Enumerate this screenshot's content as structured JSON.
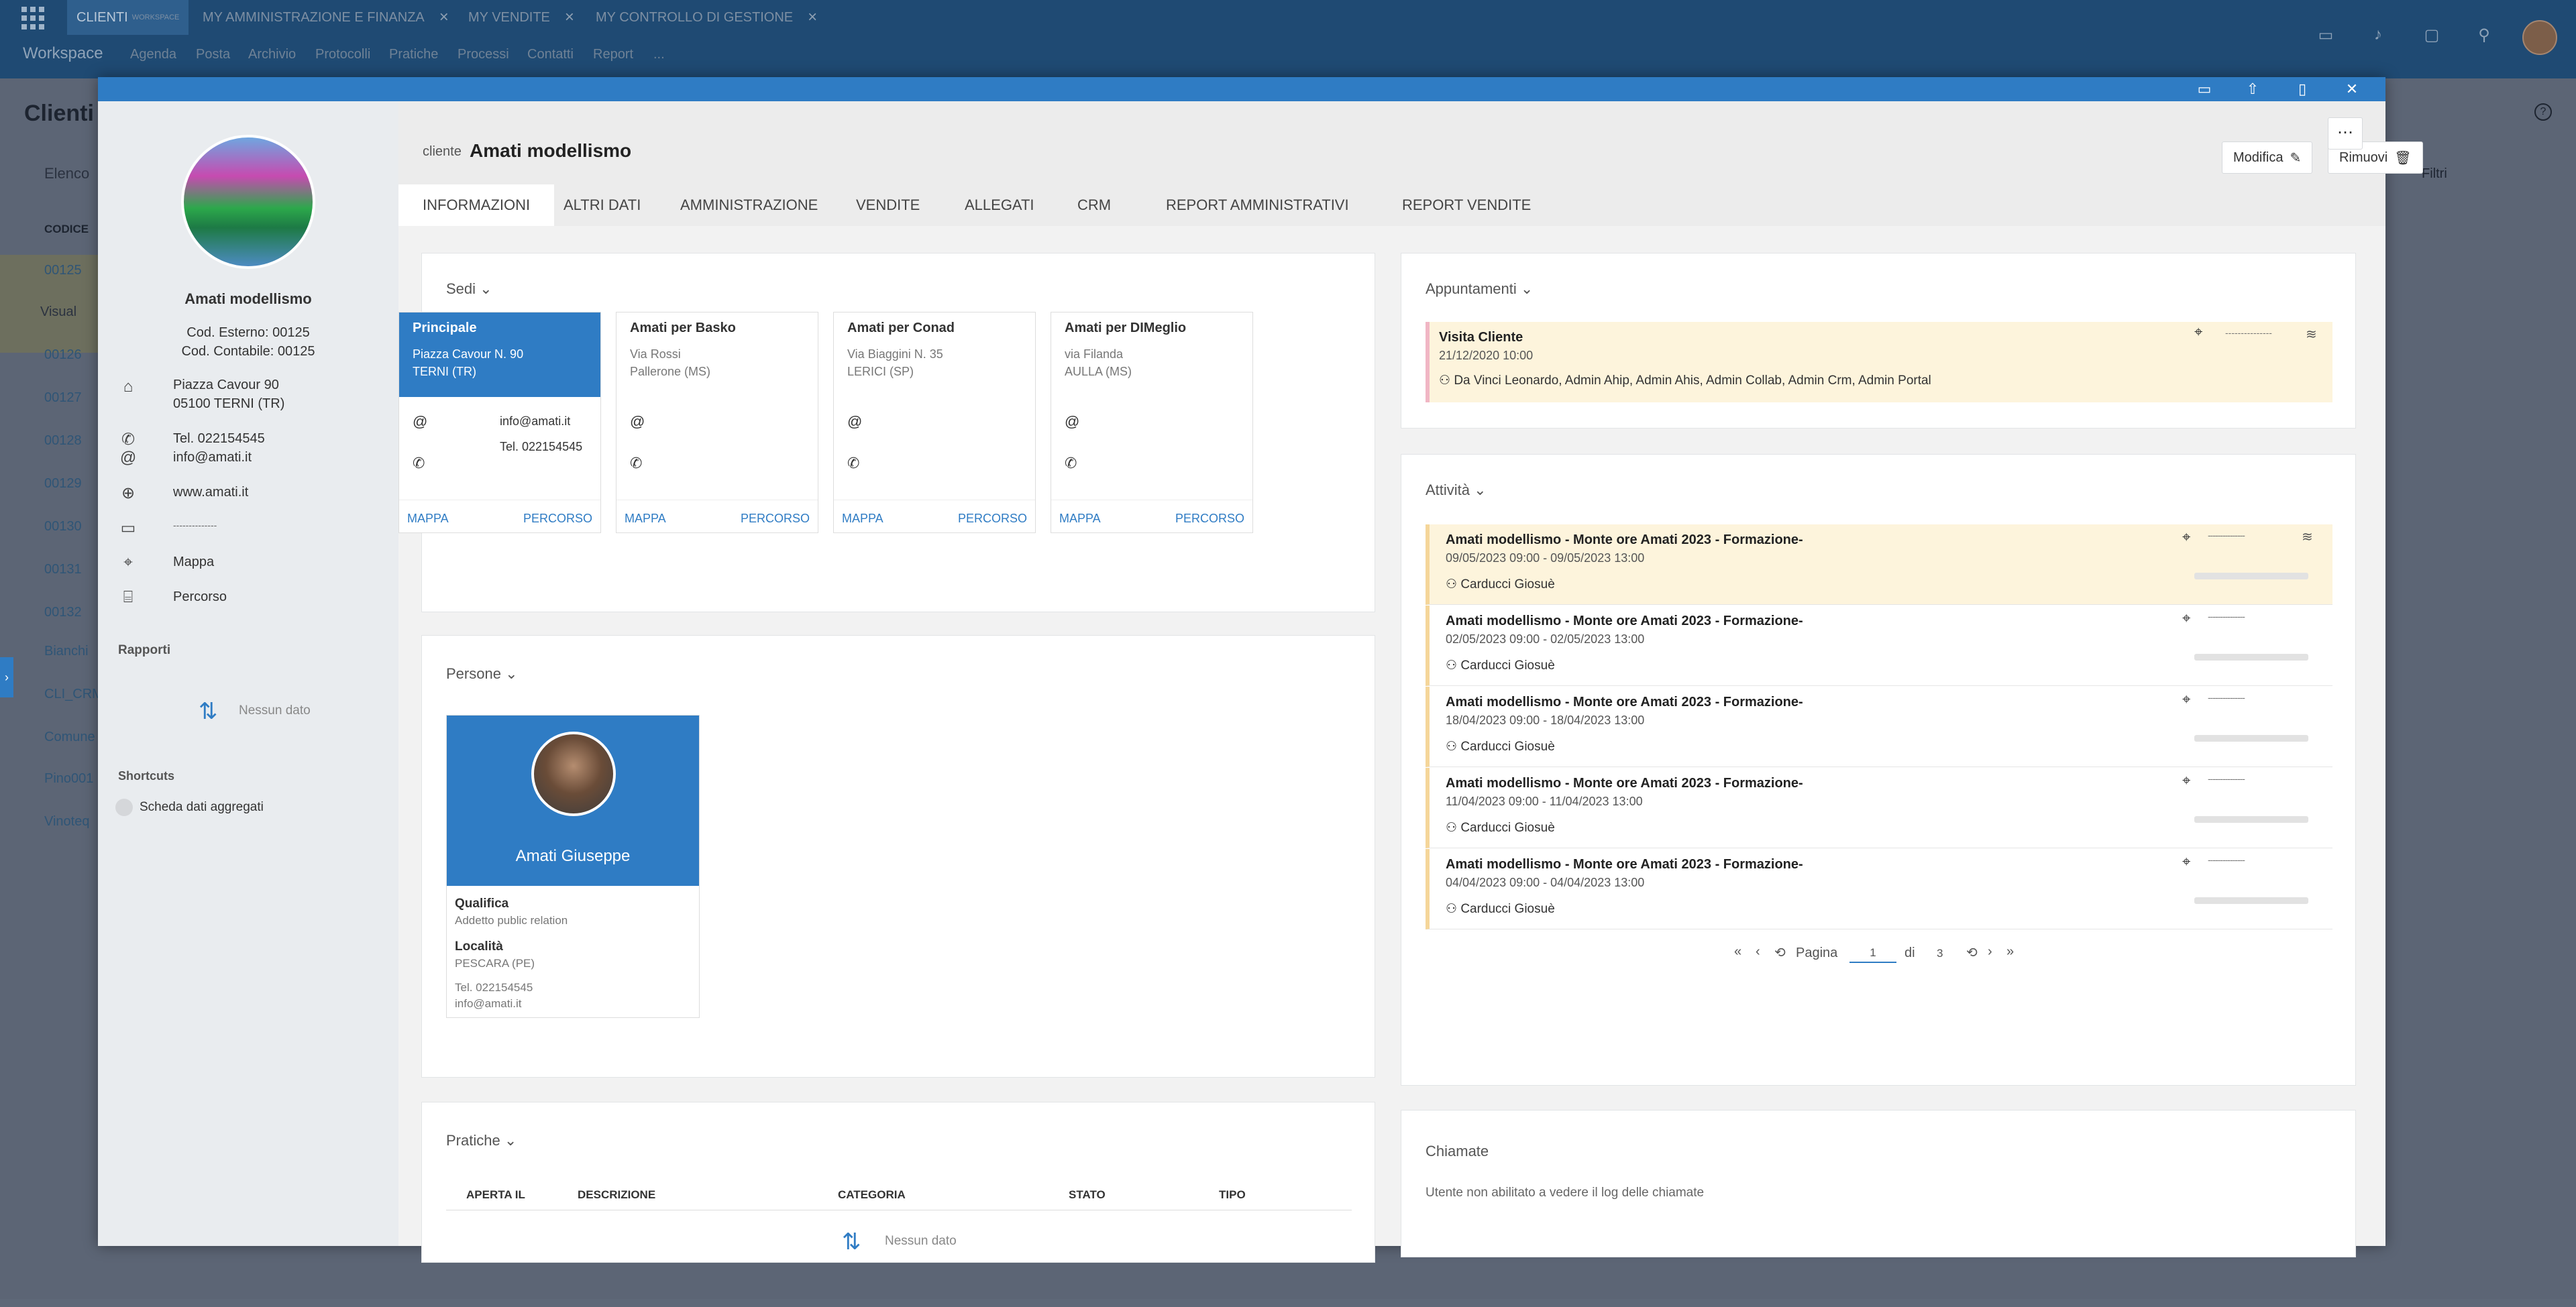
{
  "topbar": {
    "tabs": [
      {
        "label": "CLIENTI",
        "sub": "WORKSPACE"
      },
      {
        "label": "MY AMMINISTRAZIONE E FINANZA",
        "close": "×"
      },
      {
        "label": "MY VENDITE",
        "close": "×"
      },
      {
        "label": "MY CONTROLLO DI GESTIONE",
        "close": "×"
      }
    ],
    "brand": "Workspace",
    "nav": [
      "Agenda",
      "Posta",
      "Archivio",
      "Protocolli",
      "Pratiche",
      "Processi",
      "Contatti",
      "Report",
      "..."
    ]
  },
  "background": {
    "title": "Clienti",
    "elenco": "Elenco",
    "codice_header": "CODICE",
    "visual": "Visual",
    "filtri": "Filtri",
    "codes": [
      "00125",
      "00126",
      "00127",
      "00128",
      "00129",
      "00130",
      "00131",
      "00132",
      "Bianchi",
      "CLI_CRM",
      "Comune",
      "Pino001",
      "Vinoteq"
    ]
  },
  "sidebar": {
    "client_name": "Amati modellismo",
    "cod_esterno": "Cod. Esterno: 00125",
    "cod_contabile": "Cod. Contabile: 00125",
    "address1": "Piazza Cavour 90",
    "address2": "05100 TERNI (TR)",
    "phone": "Tel. 022154545",
    "email": "info@amati.it",
    "website": "www.amati.it",
    "note": "--------------",
    "map": "Mappa",
    "route": "Percorso",
    "rapporti_title": "Rapporti",
    "rapporti_empty": "Nessun dato",
    "shortcuts_title": "Shortcuts",
    "shortcut_item": "Scheda dati aggregati"
  },
  "header": {
    "prefix": "cliente",
    "title": "Amati modellismo",
    "edit_label": "Modifica",
    "remove_label": "Rimuovi",
    "more_label": "⋯"
  },
  "tabs": [
    "INFORMAZIONI",
    "ALTRI DATI",
    "AMMINISTRAZIONE",
    "VENDITE",
    "ALLEGATI",
    "CRM",
    "REPORT AMMINISTRATIVI",
    "REPORT VENDITE"
  ],
  "sedi": {
    "title": "Sedi",
    "map_label": "MAPPA",
    "route_label": "PERCORSO",
    "items": [
      {
        "name": "Principale",
        "addr1": "Piazza Cavour N. 90",
        "addr2": "TERNI (TR)",
        "email": "info@amati.it",
        "phone": "Tel. 022154545"
      },
      {
        "name": "Amati per Basko",
        "addr1": "Via Rossi",
        "addr2": "Pallerone (MS)",
        "email": "",
        "phone": ""
      },
      {
        "name": "Amati per Conad",
        "addr1": "Via Biaggini N. 35",
        "addr2": "LERICI (SP)",
        "email": "",
        "phone": ""
      },
      {
        "name": "Amati per DIMeglio",
        "addr1": "via Filanda",
        "addr2": "AULLA (MS)",
        "email": "",
        "phone": ""
      }
    ]
  },
  "persone": {
    "title": "Persone",
    "name": "Amati Giuseppe",
    "qualifica_label": "Qualifica",
    "qualifica": "Addetto public relation",
    "localita_label": "Località",
    "localita": "PESCARA (PE)",
    "phone": "Tel. 022154545",
    "email": "info@amati.it"
  },
  "pratiche": {
    "title": "Pratiche",
    "columns": [
      "APERTA IL",
      "DESCRIZIONE",
      "CATEGORIA",
      "STATO",
      "TIPO"
    ],
    "empty": "Nessun dato"
  },
  "appuntamenti": {
    "title": "Appuntamenti",
    "item": {
      "title": "Visita Cliente",
      "date": "21/12/2020 10:00",
      "people": "Da Vinci Leonardo, Admin Ahip, Admin Ahis, Admin Collab, Admin Crm, Admin Portal",
      "dash": "---------------"
    }
  },
  "attivita": {
    "title": "Attività",
    "dash": "---------------",
    "items": [
      {
        "title": "Amati modellismo - Monte ore Amati 2023 - Formazione-",
        "date": "09/05/2023 09:00 - 09/05/2023 13:00",
        "person": "Carducci Giosuè"
      },
      {
        "title": "Amati modellismo - Monte ore Amati 2023 - Formazione-",
        "date": "02/05/2023 09:00 - 02/05/2023 13:00",
        "person": "Carducci Giosuè"
      },
      {
        "title": "Amati modellismo - Monte ore Amati 2023 - Formazione-",
        "date": "18/04/2023 09:00 - 18/04/2023 13:00",
        "person": "Carducci Giosuè"
      },
      {
        "title": "Amati modellismo - Monte ore Amati 2023 - Formazione-",
        "date": "11/04/2023 09:00 - 11/04/2023 13:00",
        "person": "Carducci Giosuè"
      },
      {
        "title": "Amati modellismo - Monte ore Amati 2023 - Formazione-",
        "date": "04/04/2023 09:00 - 04/04/2023 13:00",
        "person": "Carducci Giosuè"
      }
    ],
    "pager": {
      "label": "Pagina",
      "page": "1",
      "of": "di",
      "total": "3"
    }
  },
  "chiamate": {
    "title": "Chiamate",
    "message": "Utente non abilitato a vedere il log delle chiamate"
  },
  "colors": {
    "accent": "#2f7cc4",
    "topbar": "#1f4a73",
    "highlight": "#fdf4dc"
  }
}
